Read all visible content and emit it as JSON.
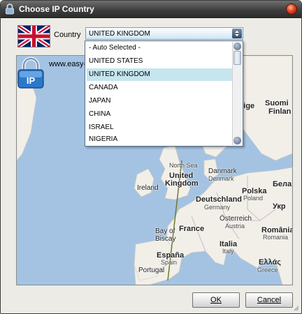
{
  "window": {
    "title": "Choose IP Country",
    "icons": [
      "lock-icon",
      "close-icon"
    ]
  },
  "country": {
    "label": "Country",
    "selected": "UNITED KINGDOM",
    "flag": "uk-flag"
  },
  "dropdown": {
    "options": [
      "- Auto Selected -",
      "UNITED STATES",
      "UNITED KINGDOM",
      "CANADA",
      "JAPAN",
      "CHINA",
      "ISRAEL",
      "NIGERIA"
    ],
    "selected_index": 2
  },
  "map": {
    "watermark": "www.easy-",
    "badge_text": "IP",
    "labels": {
      "rige": "rige",
      "suomi": "Suomi",
      "finland": "Finlan",
      "north_sea": "North Sea",
      "united": "United",
      "kingdom": "Kingdom",
      "denmark": "Danmark",
      "denmark_en": "Denmark",
      "ireland": "Ireland",
      "polska": "Polska",
      "poland": "Poland",
      "belarus": "Бела",
      "deutschland": "Deutschland",
      "germany": "Germany",
      "ukraine": "Укр",
      "france": "France",
      "osterreich": "Österreich",
      "austria": "Austria",
      "romania": "România",
      "romania_en": "Romania",
      "bay": "Bay of",
      "biscay": "Biscay",
      "italia": "Italia",
      "italy": "Italy",
      "espana": "España",
      "spain": "Spain",
      "portugal": "Portugal",
      "ellas": "Ελλάς",
      "greece": "Greece"
    }
  },
  "buttons": {
    "ok": "OK",
    "cancel": "Cancel"
  },
  "colors": {
    "title_bar": "#3f3f3f",
    "sea": "#a4c3e2",
    "land": "#f1efe8",
    "selection": "#c5e6ef",
    "close_button": "#e0421c"
  }
}
